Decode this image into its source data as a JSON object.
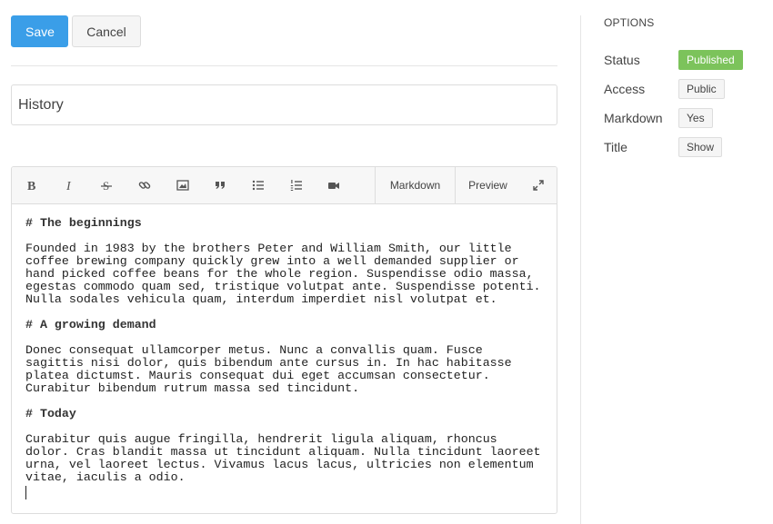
{
  "actions": {
    "save_label": "Save",
    "cancel_label": "Cancel"
  },
  "title_field": {
    "value": "History"
  },
  "toolbar": {
    "tools": [
      {
        "name": "bold-icon"
      },
      {
        "name": "italic-icon"
      },
      {
        "name": "strikethrough-icon"
      },
      {
        "name": "link-icon"
      },
      {
        "name": "image-icon"
      },
      {
        "name": "blockquote-icon"
      },
      {
        "name": "bullet-list-icon"
      },
      {
        "name": "numbered-list-icon"
      },
      {
        "name": "video-icon"
      }
    ],
    "markdown_label": "Markdown",
    "preview_label": "Preview"
  },
  "editor": {
    "h1": "# The beginnings",
    "p1": [
      "Founded in 1983 by the brothers Peter and William Smith, our little",
      "coffee brewing company quickly grew into a well demanded supplier or",
      "hand picked coffee beans for the whole region. Suspendisse odio massa,",
      "egestas commodo quam sed, tristique volutpat ante. Suspendisse potenti.",
      "Nulla sodales vehicula quam, interdum imperdiet nisl volutpat et."
    ],
    "h2": "# A growing demand",
    "p2": [
      "Donec consequat ullamcorper metus. Nunc a convallis quam. Fusce",
      "sagittis nisi dolor, quis bibendum ante cursus in. In hac habitasse",
      "platea dictumst. Mauris consequat dui eget accumsan consectetur.",
      "Curabitur bibendum rutrum massa sed tincidunt."
    ],
    "h3": "# Today",
    "p3": [
      "Curabitur quis augue fringilla, hendrerit ligula aliquam, rhoncus",
      "dolor. Cras blandit massa ut tincidunt aliquam. Nulla tincidunt laoreet",
      "urna, vel laoreet lectus. Vivamus lacus lacus, ultricies non elementum",
      "vitae, iaculis a odio."
    ]
  },
  "sidebar": {
    "title": "OPTIONS",
    "options": [
      {
        "label": "Status",
        "value": "Published"
      },
      {
        "label": "Access",
        "value": "Public"
      },
      {
        "label": "Markdown",
        "value": "Yes"
      },
      {
        "label": "Title",
        "value": "Show"
      }
    ]
  },
  "colors": {
    "primary": "#3a9ee8",
    "success": "#7cc35b"
  }
}
